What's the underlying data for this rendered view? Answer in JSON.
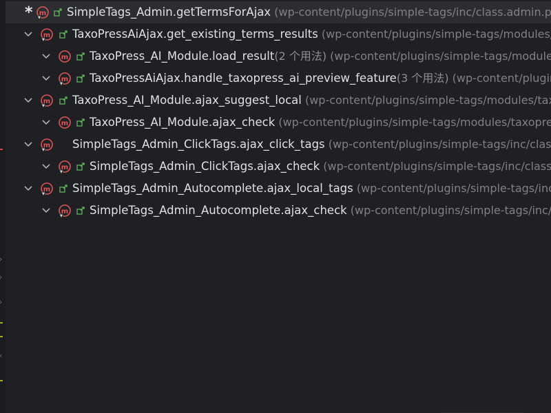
{
  "tree": {
    "rows": [
      {
        "name": "SimpleTags_Admin.getTermsForAjax",
        "usage": "",
        "path": " (wp-content/plugins/simple-tags/inc/class.admin.php)"
      },
      {
        "name": "TaxoPressAiAjax.get_existing_terms_results",
        "usage": "",
        "path": " (wp-content/plugins/simple-tags/modules/taxopress-ai/taxopress-ai-ajax.php)"
      },
      {
        "name": "TaxoPress_AI_Module.load_result",
        "usage": "(2 个用法)",
        "path": " (wp-content/plugins/simple-tags/modules/taxopress-ai/taxopress-ai.php)"
      },
      {
        "name": "TaxoPressAiAjax.handle_taxopress_ai_preview_feature",
        "usage": "(3 个用法)",
        "path": " (wp-content/plugins/simple-tags/modules/taxopress-ai)"
      },
      {
        "name": "TaxoPress_AI_Module.ajax_suggest_local",
        "usage": "",
        "path": " (wp-content/plugins/simple-tags/modules/taxopress-ai/taxopress-ai.php)"
      },
      {
        "name": "TaxoPress_AI_Module.ajax_check",
        "usage": "",
        "path": " (wp-content/plugins/simple-tags/modules/taxopress-ai/taxopress-ai.php)"
      },
      {
        "name": "SimpleTags_Admin_ClickTags.ajax_click_tags",
        "usage": "",
        "path": " (wp-content/plugins/simple-tags/inc/class.admin.clicktags.php)"
      },
      {
        "name": "SimpleTags_Admin_ClickTags.ajax_check",
        "usage": "",
        "path": " (wp-content/plugins/simple-tags/inc/class.admin.clicktags.php)"
      },
      {
        "name": "SimpleTags_Admin_Autocomplete.ajax_local_tags",
        "usage": "",
        "path": " (wp-content/plugins/simple-tags/inc/class.admin.autocomplete.php)"
      },
      {
        "name": "SimpleTags_Admin_Autocomplete.ajax_check",
        "usage": "",
        "path": " (wp-content/plugins/simple-tags/inc/class.admin.autocomplete.php)"
      }
    ],
    "root_marker": "*"
  },
  "icons": {
    "chevron": "chevron-down-icon",
    "method": "method-m-icon",
    "override": "override-arrow-icon",
    "access": "public-access-icon"
  },
  "colors": {
    "background": "#1f2023",
    "selected_row": "#2b2d31",
    "name_text": "#dfe1e5",
    "path_text": "#7e8288",
    "method_icon": "#e05555",
    "access_icon": "#5fb85f"
  }
}
